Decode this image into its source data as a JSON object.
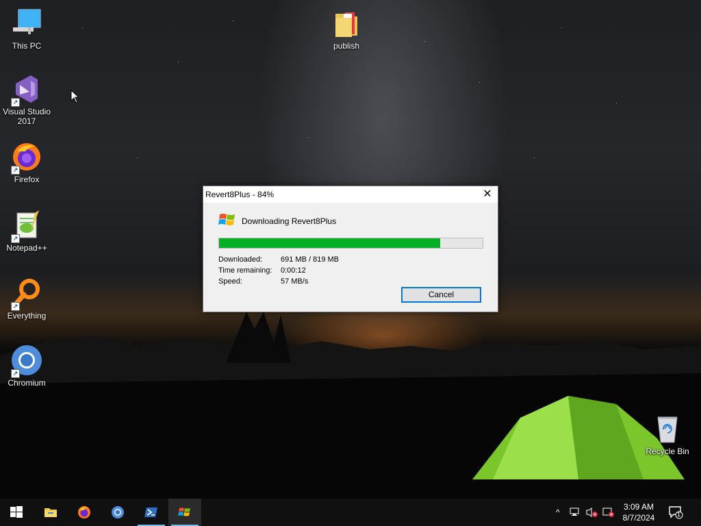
{
  "desktop": {
    "icons": [
      {
        "label": "This PC",
        "icon": "this-pc-icon"
      },
      {
        "label": "Visual Studio 2017",
        "icon": "visual-studio-icon"
      },
      {
        "label": "Firefox",
        "icon": "firefox-icon"
      },
      {
        "label": "Notepad++",
        "icon": "notepad-plus-plus-icon"
      },
      {
        "label": "Everything",
        "icon": "everything-search-icon"
      },
      {
        "label": "Chromium",
        "icon": "chromium-icon"
      },
      {
        "label": "publish",
        "icon": "folder-icon"
      },
      {
        "label": "Recycle Bin",
        "icon": "recycle-bin-icon"
      }
    ]
  },
  "dialog": {
    "title": "Revert8Plus - 84%",
    "heading": "Downloading Revert8Plus",
    "progress_percent": 84,
    "downloaded_label": "Downloaded:",
    "downloaded_value": "691 MB / 819 MB",
    "time_remaining_label": "Time remaining:",
    "time_remaining_value": "0:00:12",
    "speed_label": "Speed:",
    "speed_value": "57 MB/s",
    "cancel_label": "Cancel",
    "close_glyph": "✕"
  },
  "taskbar": {
    "items": [
      "start-icon",
      "file-explorer-icon",
      "firefox-icon",
      "chromium-icon",
      "powershell-icon",
      "revert8plus-icon"
    ],
    "clock_time": "3:09 AM",
    "clock_date": "8/7/2024",
    "notification_count": "1",
    "tray_chevron": "^"
  },
  "colors": {
    "progress_fill": "#06b025",
    "accent": "#0078d7",
    "taskbar": "#101010"
  }
}
